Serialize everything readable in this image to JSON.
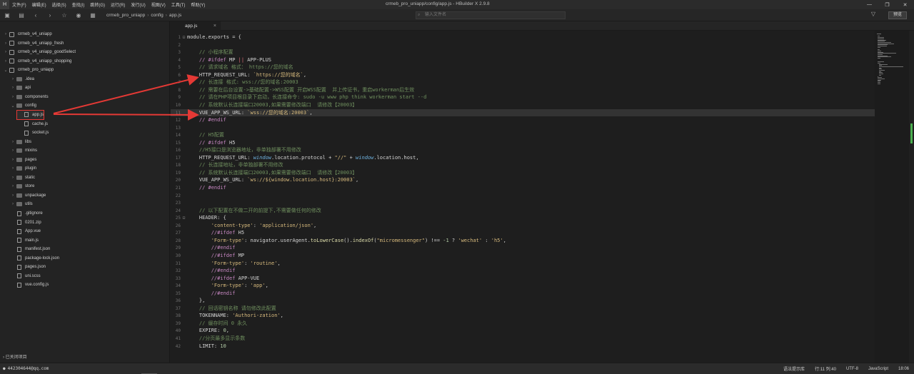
{
  "menubar": {
    "logo": "H",
    "items": [
      "文件(F)",
      "编辑(E)",
      "选择(S)",
      "查找(I)",
      "跳转(G)",
      "运行(R)",
      "发行(U)",
      "视图(V)",
      "工具(T)",
      "帮助(Y)"
    ],
    "window_title": "crmeb_pro_uniapp/config/app.js - HBuilder X 2.9.8"
  },
  "toolbar": {
    "breadcrumb": [
      "crmeb_pro_uniapp",
      "config",
      "app.js"
    ],
    "search_placeholder": "输入文件名",
    "preview_label": "预览"
  },
  "sidebar": {
    "projects": [
      {
        "name": "crmeb_v4_uniapp"
      },
      {
        "name": "crmeb_v4_uniapp_fresh"
      },
      {
        "name": "crmeb_v4_uniapp_goodSelect"
      },
      {
        "name": "crmeb_v4_uniapp_shopping"
      },
      {
        "name": "crmeb_pro_uniapp"
      }
    ],
    "pro_children": [
      {
        "name": ".idea",
        "type": "folder"
      },
      {
        "name": "api",
        "type": "folder"
      },
      {
        "name": "components",
        "type": "folder"
      },
      {
        "name": "config",
        "type": "folder-open"
      },
      {
        "name": "app.js",
        "type": "file",
        "depth": 2
      },
      {
        "name": "cache.js",
        "type": "file",
        "depth": 2
      },
      {
        "name": "socket.js",
        "type": "file",
        "depth": 2
      },
      {
        "name": "libs",
        "type": "folder"
      },
      {
        "name": "mixins",
        "type": "folder"
      },
      {
        "name": "pages",
        "type": "folder"
      },
      {
        "name": "plugin",
        "type": "folder"
      },
      {
        "name": "static",
        "type": "folder"
      },
      {
        "name": "store",
        "type": "folder"
      },
      {
        "name": "unpackage",
        "type": "folder"
      },
      {
        "name": "utils",
        "type": "folder"
      },
      {
        "name": ".gitignore",
        "type": "file"
      },
      {
        "name": "0201.zip",
        "type": "file"
      },
      {
        "name": "App.vue",
        "type": "file"
      },
      {
        "name": "main.js",
        "type": "file"
      },
      {
        "name": "manifest.json",
        "type": "file"
      },
      {
        "name": "package-lock.json",
        "type": "file"
      },
      {
        "name": "pages.json",
        "type": "file"
      },
      {
        "name": "uni.scss",
        "type": "file"
      },
      {
        "name": "vue.config.js",
        "type": "file"
      }
    ],
    "closed_projects": "已关闭项目"
  },
  "tabs": [
    {
      "label": "app.js"
    }
  ],
  "editor": {
    "lines": [
      {
        "n": "1",
        "fold": "⊟",
        "html": "module.exports = {"
      },
      {
        "n": "2",
        "fold": "",
        "html": ""
      },
      {
        "n": "3",
        "fold": "",
        "html": "    <span class=\"c-com\">// 小程序配置</span>"
      },
      {
        "n": "4",
        "fold": "",
        "html": "    <span class=\"c-dir\">// #ifdef</span> MP <span class=\"c-red\">||</span> APP-PLUS"
      },
      {
        "n": "5",
        "fold": "",
        "html": "    <span class=\"c-com\">// 请求域名 格式： https://您的域名</span>"
      },
      {
        "n": "6",
        "fold": "",
        "html": "    HTTP_REQUEST_URL: <span class=\"c-str\">`https://您的域名`</span>,"
      },
      {
        "n": "7",
        "fold": "",
        "html": "    <span class=\"c-com\">// 长连接 格式: wss://您的域名:20003</span>"
      },
      {
        "n": "8",
        "fold": "",
        "html": "    <span class=\"c-com\">// 需要在后台设置->基础配置->WSS配置 开启WSS配置  并上传证书，重启workerman后生效</span>"
      },
      {
        "n": "9",
        "fold": "",
        "html": "    <span class=\"c-com\">// 请在PHP项目根目录下启动，长连接命令: sudo -u www php think workerman start --d</span>"
      },
      {
        "n": "10",
        "fold": "",
        "html": "    <span class=\"c-com\">// 系统默认长连接端口20003,如果需要修改端口  请修改【20003】</span>"
      },
      {
        "n": "11",
        "fold": "",
        "html": "    VUE_APP_WS_URL: <span class=\"c-str\">`wss://您的域名:20003`</span>,",
        "hl": true
      },
      {
        "n": "12",
        "fold": "",
        "html": "    <span class=\"c-dir\">// #endif</span>"
      },
      {
        "n": "13",
        "fold": "",
        "html": ""
      },
      {
        "n": "14",
        "fold": "",
        "html": "    <span class=\"c-com\">// H5配置</span>"
      },
      {
        "n": "15",
        "fold": "",
        "html": "    <span class=\"c-dir\">// #ifdef</span> H5"
      },
      {
        "n": "16",
        "fold": "",
        "html": "    <span class=\"c-com\">//H5接口是浏览器地址，非单独部署不用修改</span>"
      },
      {
        "n": "17",
        "fold": "",
        "html": "    HTTP_REQUEST_URL: <span class=\"c-var\">window</span>.location.protocol + <span class=\"c-str\">\"//\"</span> + <span class=\"c-var\">window</span>.location.host,"
      },
      {
        "n": "18",
        "fold": "",
        "html": "    <span class=\"c-com\">// 长连接地址，非单独部署不用修改</span>"
      },
      {
        "n": "19",
        "fold": "",
        "html": "    <span class=\"c-com\">// 系统默认长连接端口20003,如果需要修改端口  请修改【20003】</span>"
      },
      {
        "n": "20",
        "fold": "",
        "html": "    VUE_APP_WS_URL: <span class=\"c-str\">`ws://${window.location.host}:20003`</span>,"
      },
      {
        "n": "21",
        "fold": "",
        "html": "    <span class=\"c-dir\">// #endif</span>"
      },
      {
        "n": "22",
        "fold": "",
        "html": ""
      },
      {
        "n": "23",
        "fold": "",
        "html": ""
      },
      {
        "n": "24",
        "fold": "",
        "html": "    <span class=\"c-com\">// 以下配置在不做二开的前提下,不需要做任何的修改</span>"
      },
      {
        "n": "25",
        "fold": "⊟",
        "html": "    HEADER: {"
      },
      {
        "n": "26",
        "fold": "",
        "html": "        <span class=\"c-str\">'content-type'</span>: <span class=\"c-str\">'application/json'</span>,"
      },
      {
        "n": "27",
        "fold": "",
        "html": "        <span class=\"c-dir\">//#ifdef</span> H5"
      },
      {
        "n": "28",
        "fold": "",
        "html": "        <span class=\"c-str\">'Form-type'</span>: navigator.userAgent.<span class=\"c-fn\">toLowerCase</span>().<span class=\"c-fn\">indexOf</span>(<span class=\"c-str\">\"micromessenger\"</span>) !== <span class=\"c-num\">-1</span> ? <span class=\"c-str\">'wechat'</span> : <span class=\"c-str\">'h5'</span>,"
      },
      {
        "n": "29",
        "fold": "",
        "html": "        <span class=\"c-dir\">//#endif</span>"
      },
      {
        "n": "30",
        "fold": "",
        "html": "        <span class=\"c-dir\">//#ifdef</span> MP"
      },
      {
        "n": "31",
        "fold": "",
        "html": "        <span class=\"c-str\">'Form-type'</span>: <span class=\"c-str\">'routine'</span>,"
      },
      {
        "n": "32",
        "fold": "",
        "html": "        <span class=\"c-dir\">//#endif</span>"
      },
      {
        "n": "33",
        "fold": "",
        "html": "        <span class=\"c-dir\">//#ifdef</span> APP-VUE"
      },
      {
        "n": "34",
        "fold": "",
        "html": "        <span class=\"c-str\">'Form-type'</span>: <span class=\"c-str\">'app'</span>,"
      },
      {
        "n": "35",
        "fold": "",
        "html": "        <span class=\"c-dir\">//#endif</span>"
      },
      {
        "n": "36",
        "fold": "",
        "html": "    },"
      },
      {
        "n": "37",
        "fold": "",
        "html": "    <span class=\"c-com\">// 回话密钥名称 请勿修改此配置</span>"
      },
      {
        "n": "38",
        "fold": "",
        "html": "    TOKENNAME: <span class=\"c-str\">'Authori-zation'</span>,"
      },
      {
        "n": "39",
        "fold": "",
        "html": "    <span class=\"c-com\">// 缓存时间 0 永久</span>"
      },
      {
        "n": "40",
        "fold": "",
        "html": "    EXPIRE: <span class=\"c-num\">0</span>,"
      },
      {
        "n": "41",
        "fold": "",
        "html": "    <span class=\"c-com\">//分页最多显示条数</span>"
      },
      {
        "n": "42",
        "fold": "",
        "html": "    LIMIT: <span class=\"c-num\">10</span>"
      }
    ]
  },
  "statusbar": {
    "account": "442304644@qq.com",
    "items": [
      "语法提示库",
      "行:11  列:40",
      "UTF-8",
      "JavaScript"
    ],
    "time": "18:06"
  },
  "colors": {
    "arrow": "#e53935",
    "highlight": "#333333"
  }
}
